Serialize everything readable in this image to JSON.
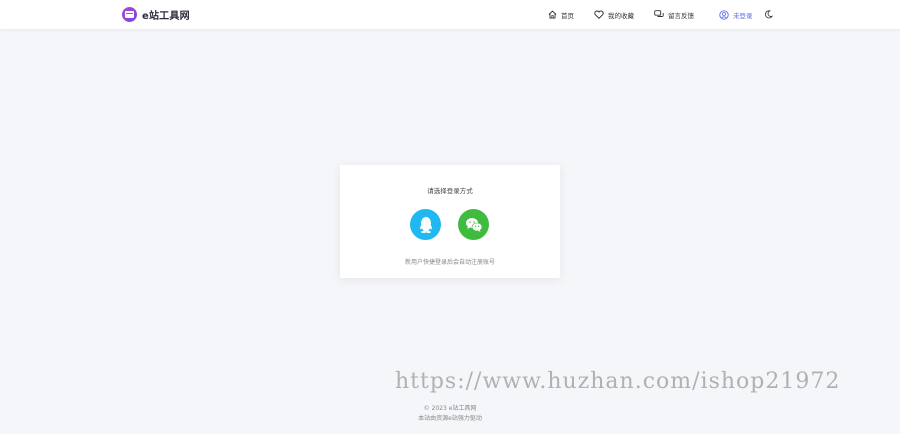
{
  "header": {
    "brand": "e站工具网",
    "nav": {
      "home": "首页",
      "favorites": "我的收藏",
      "feedback": "留言反馈",
      "login": "未登录"
    }
  },
  "login_card": {
    "title": "请选择登录方式",
    "hint": "新用户快捷登录后会自动注册账号",
    "methods": [
      "qq-icon",
      "wechat-icon"
    ]
  },
  "watermark": "https://www.huzhan.com/ishop21972",
  "footer": {
    "copyright": "© 2023 e站工具网",
    "powered": "本站由资源e站强力驱动"
  },
  "colors": {
    "accent": "#5b6cf0",
    "qq": "#20b8f0",
    "wechat": "#3fbc3f",
    "brand": "#b04bd3"
  }
}
